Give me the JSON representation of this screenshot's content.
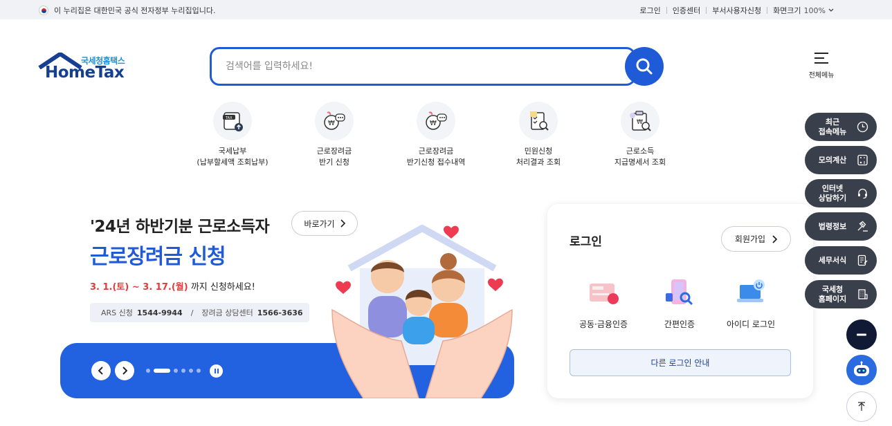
{
  "topbar": {
    "gov_notice": "이 누리집은 대한민국 공식 전자정부 누리집입니다.",
    "links": [
      "로그인",
      "인증센터",
      "부서사용자신청"
    ],
    "zoom_label": "화면크기",
    "zoom_value": "100%"
  },
  "logo": {
    "sub": "국세청홈택스",
    "main": "HomeTax"
  },
  "search": {
    "placeholder": "검색어를 입력하세요!"
  },
  "all_menu": {
    "label": "전체메뉴"
  },
  "quick_menu": [
    {
      "line1": "국세납부",
      "line2": "(납부할세액 조회납부)",
      "icon": "tax-payment-icon"
    },
    {
      "line1": "근로장려금",
      "line2": "반기 신청",
      "icon": "won-chat-icon"
    },
    {
      "line1": "근로장려금",
      "line2": "반기신청 접수내역",
      "icon": "won-chat-icon"
    },
    {
      "line1": "민원신청",
      "line2": "처리결과 조회",
      "icon": "document-search-icon"
    },
    {
      "line1": "근로소득",
      "line2": "지급명세서 조회",
      "icon": "clipboard-won-icon"
    }
  ],
  "banner": {
    "line1": "'24년 하반기분 근로소득자",
    "line2": "근로장려금 신청",
    "date": "3. 1.(토) ~ 3. 17.(월)",
    "date_suffix": "까지 신청하세요!",
    "go_label": "바로가기",
    "ars_label": "ARS 신청",
    "ars_number": "1544-9944",
    "ars_sep": "/",
    "center_label": "장려금 상담센터",
    "center_number": "1566-3636"
  },
  "login": {
    "title": "로그인",
    "join_label": "회원가입",
    "options": [
      "공동·금융인증",
      "간편인증",
      "아이디 로그인"
    ],
    "other_label": "다른 로그인 안내"
  },
  "side_menu": [
    {
      "label1": "최근",
      "label2": "접속메뉴",
      "icon": "clock-icon"
    },
    {
      "label1": "모의계산",
      "label2": "",
      "icon": "calculator-icon"
    },
    {
      "label1": "인터넷",
      "label2": "상담하기",
      "icon": "headset-icon"
    },
    {
      "label1": "법령정보",
      "label2": "",
      "icon": "gavel-icon"
    },
    {
      "label1": "세무서식",
      "label2": "",
      "icon": "form-icon"
    },
    {
      "label1": "국세청",
      "label2": "홈페이지",
      "icon": "building-icon"
    }
  ],
  "colors": {
    "primary": "#1f5bd6",
    "banner": "#2262e0",
    "side": "#3a3f4c",
    "accent_red": "#e23b3b"
  }
}
